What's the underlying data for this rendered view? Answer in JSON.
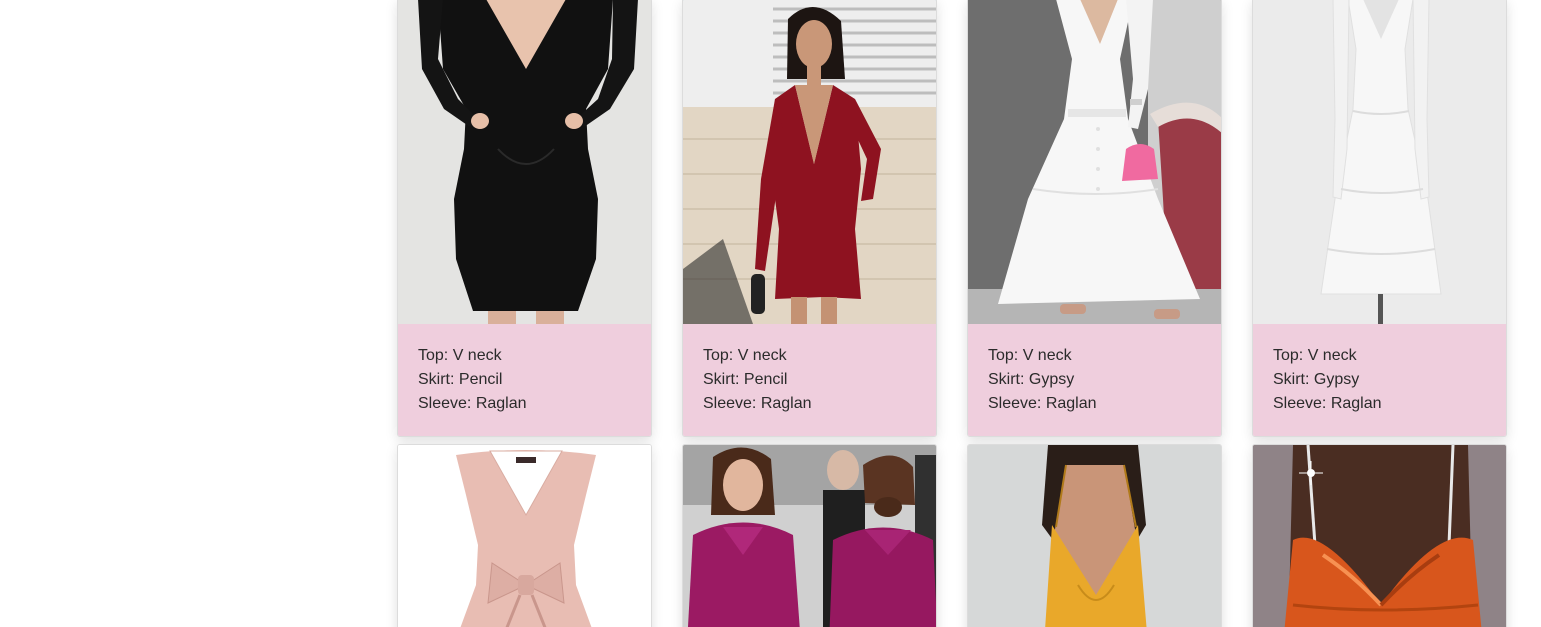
{
  "products": [
    {
      "top": "Top: V neck",
      "skirt": "Skirt: Pencil",
      "sleeve": "Sleeve: Raglan",
      "image": "black-dress-photo"
    },
    {
      "top": "Top: V neck",
      "skirt": "Skirt: Pencil",
      "sleeve": "Sleeve: Raglan",
      "image": "red-dress-photo"
    },
    {
      "top": "Top: V neck",
      "skirt": "Skirt: Gypsy",
      "sleeve": "Sleeve: Raglan",
      "image": "white-maxi-dress-photo"
    },
    {
      "top": "Top: V neck",
      "skirt": "Skirt: Gypsy",
      "sleeve": "Sleeve: Raglan",
      "image": "white-tiered-dress-photo"
    },
    {
      "image": "pink-bow-dress-photo"
    },
    {
      "image": "purple-dress-photo"
    },
    {
      "image": "yellow-slip-dress-photo"
    },
    {
      "image": "orange-satin-dress-photo"
    }
  ],
  "colors": {
    "card_info_bg": "#efcedd",
    "text": "#2b2b2b"
  }
}
